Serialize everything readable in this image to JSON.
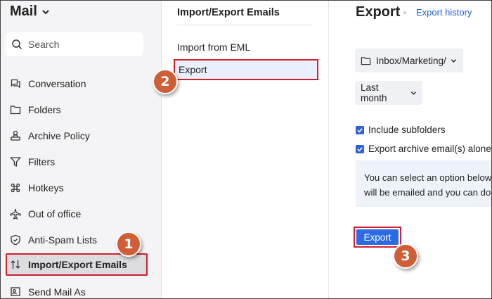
{
  "app": {
    "title": "Mail"
  },
  "search": {
    "placeholder": "Search"
  },
  "sidebar": {
    "items": [
      {
        "label": "Conversation",
        "icon": "conversation-icon"
      },
      {
        "label": "Folders",
        "icon": "folder-icon"
      },
      {
        "label": "Archive Policy",
        "icon": "archive-policy-icon"
      },
      {
        "label": "Filters",
        "icon": "filter-icon"
      },
      {
        "label": "Hotkeys",
        "icon": "command-key-icon"
      },
      {
        "label": "Out of office",
        "icon": "airplane-icon"
      },
      {
        "label": "Anti-Spam Lists",
        "icon": "shield-icon"
      },
      {
        "label": "Import/Export Emails",
        "icon": "import-export-icon",
        "active": true
      },
      {
        "label": "Send Mail As",
        "icon": "send-as-icon"
      }
    ]
  },
  "middle": {
    "title": "Import/Export Emails",
    "items": [
      {
        "label": "Import from EML"
      },
      {
        "label": "Export",
        "selected": true
      }
    ]
  },
  "export_panel": {
    "title": "Export",
    "history_link": "Export history",
    "folder_value": "Inbox/Marketing/",
    "range_value": "Last month",
    "include_subfolders": {
      "label": "Include subfolders",
      "checked": true
    },
    "export_archive": {
      "label": "Export archive email(s) alone",
      "checked": true
    },
    "info_line1": "You can select an option below",
    "info_line2": "will be emailed and you can dov",
    "export_button": "Export"
  },
  "steps": [
    "1",
    "2",
    "3"
  ],
  "colors": {
    "accent": "#2c6be3",
    "highlight_border": "#d12030",
    "step_badge": "#cf5e36",
    "sidebar_bg": "#f4f4f6",
    "link": "#1e5fd6"
  }
}
